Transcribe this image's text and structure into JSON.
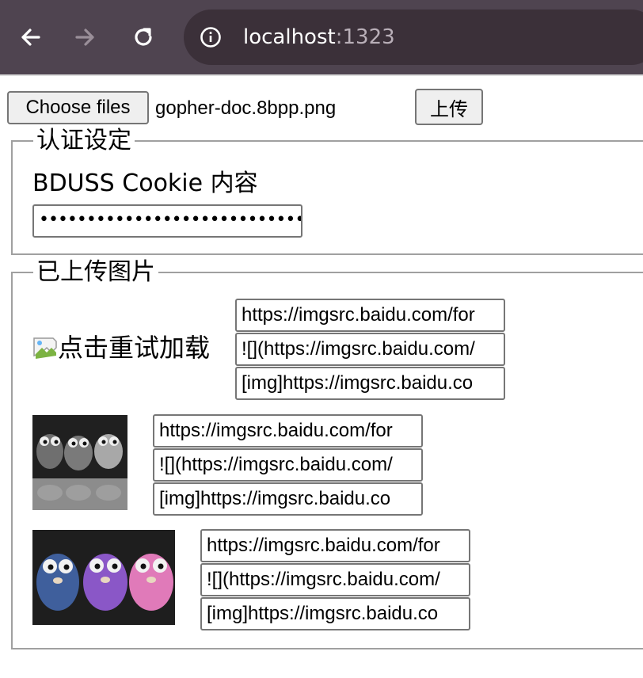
{
  "browser": {
    "host": "localhost",
    "port": ":1323"
  },
  "upload": {
    "choose_label": "Choose files",
    "file_name": "gopher-doc.8bpp.png",
    "submit_label": "上传"
  },
  "auth": {
    "legend": "认证设定",
    "cookie_label": "BDUSS Cookie 内容",
    "cookie_value": "••••••••••••••••••••••••••••••••••"
  },
  "uploaded": {
    "legend": "已上传图片",
    "items": [
      {
        "image_alt": "点击重试加载",
        "url": "https://imgsrc.baidu.com/for",
        "markdown": "![](https://imgsrc.baidu.com/",
        "bbcode": "[img]https://imgsrc.baidu.co"
      },
      {
        "image_alt": "",
        "url": "https://imgsrc.baidu.com/for",
        "markdown": "![](https://imgsrc.baidu.com/",
        "bbcode": "[img]https://imgsrc.baidu.co"
      },
      {
        "image_alt": "",
        "url": "https://imgsrc.baidu.com/for",
        "markdown": "![](https://imgsrc.baidu.com/",
        "bbcode": "[img]https://imgsrc.baidu.co"
      }
    ]
  },
  "colors": {
    "chrome_bg": "#4f4450",
    "omnibox_bg": "#3b3039"
  }
}
